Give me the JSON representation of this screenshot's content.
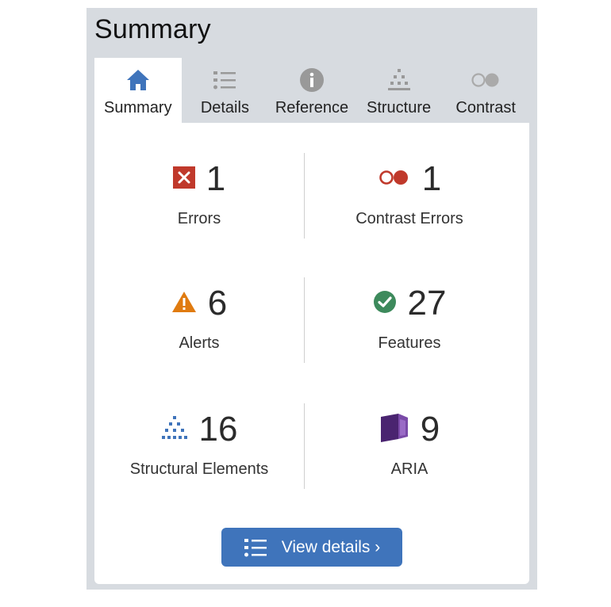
{
  "panel": {
    "title": "Summary"
  },
  "tabs": [
    {
      "label": "Summary",
      "icon": "home-icon",
      "active": true
    },
    {
      "label": "Details",
      "icon": "list-icon"
    },
    {
      "label": "Reference",
      "icon": "info-icon"
    },
    {
      "label": "Structure",
      "icon": "structure-icon"
    },
    {
      "label": "Contrast",
      "icon": "contrast-icon"
    }
  ],
  "stats": {
    "errors": {
      "count": "1",
      "label": "Errors",
      "icon": "error-icon"
    },
    "contrast_errors": {
      "count": "1",
      "label": "Contrast Errors",
      "icon": "contrast-error-icon"
    },
    "alerts": {
      "count": "6",
      "label": "Alerts",
      "icon": "alert-icon"
    },
    "features": {
      "count": "27",
      "label": "Features",
      "icon": "feature-icon"
    },
    "structural": {
      "count": "16",
      "label": "Structural Elements",
      "icon": "structure-icon"
    },
    "aria": {
      "count": "9",
      "label": "ARIA",
      "icon": "aria-icon"
    }
  },
  "actions": {
    "view_details": "View details ›"
  },
  "colors": {
    "panel_bg": "#d7dbe0",
    "accent": "#3f74bb",
    "error": "#c0392b",
    "alert": "#e07b10",
    "feature": "#3d8a5c",
    "aria": "#4a2470"
  }
}
